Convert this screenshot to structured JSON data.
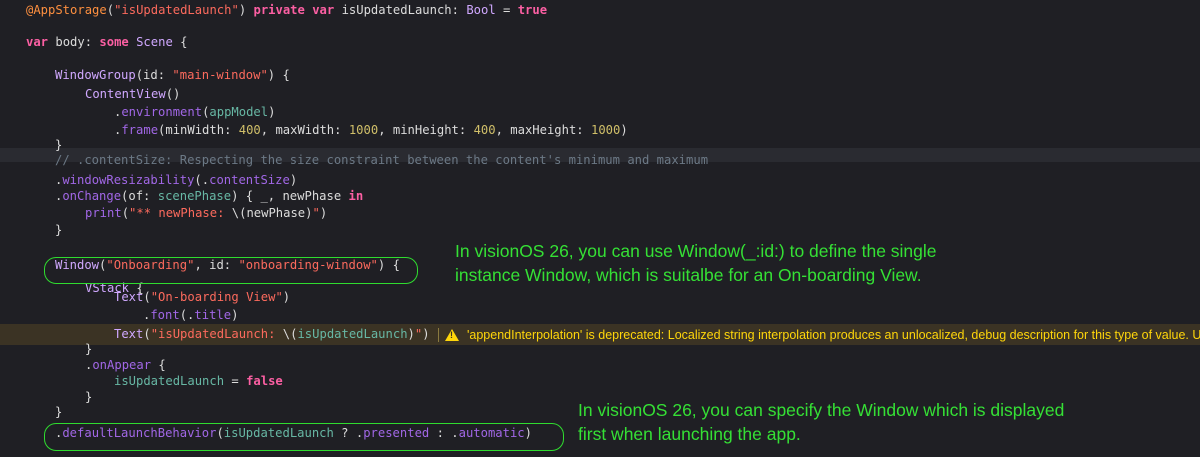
{
  "code_lines": [
    {
      "segments": [
        [
          "attr",
          "@AppStorage"
        ],
        [
          "plain",
          "("
        ],
        [
          "str",
          "\"isUpdatedLaunch\""
        ],
        [
          "plain",
          ") "
        ],
        [
          "kw",
          "private"
        ],
        [
          "plain",
          " "
        ],
        [
          "kw",
          "var"
        ],
        [
          "plain",
          " isUpdatedLaunch: "
        ],
        [
          "type",
          "Bool"
        ],
        [
          "plain",
          " = "
        ],
        [
          "kw",
          "true"
        ]
      ]
    },
    {
      "segments": []
    },
    {
      "segments": [
        [
          "kw",
          "var"
        ],
        [
          "plain",
          " body: "
        ],
        [
          "kw",
          "some"
        ],
        [
          "plain",
          " "
        ],
        [
          "type",
          "Scene"
        ],
        [
          "plain",
          " {"
        ]
      ]
    },
    {
      "segments": []
    },
    {
      "segments": [
        [
          "type",
          "WindowGroup"
        ],
        [
          "plain",
          "(id: "
        ],
        [
          "str",
          "\"main-window\""
        ],
        [
          "plain",
          ") {"
        ]
      ]
    },
    {
      "segments": [
        [
          "type",
          "ContentView"
        ],
        [
          "plain",
          "()"
        ]
      ]
    },
    {
      "segments": [
        [
          "plain",
          "."
        ],
        [
          "member",
          "environment"
        ],
        [
          "plain",
          "("
        ],
        [
          "prop",
          "appModel"
        ],
        [
          "plain",
          ")"
        ]
      ]
    },
    {
      "segments": [
        [
          "plain",
          "."
        ],
        [
          "member",
          "frame"
        ],
        [
          "plain",
          "(minWidth: "
        ],
        [
          "num",
          "400"
        ],
        [
          "plain",
          ", maxWidth: "
        ],
        [
          "num",
          "1000"
        ],
        [
          "plain",
          ", minHeight: "
        ],
        [
          "num",
          "400"
        ],
        [
          "plain",
          ", maxHeight: "
        ],
        [
          "num",
          "1000"
        ],
        [
          "plain",
          ")"
        ]
      ]
    },
    {
      "segments": [
        [
          "plain",
          "}"
        ]
      ]
    },
    {
      "segments": [
        [
          "cmt",
          "// .contentSize: Respecting the size constraint between the content's minimum and maximum"
        ]
      ]
    },
    {
      "segments": [
        [
          "plain",
          "."
        ],
        [
          "member",
          "windowResizability"
        ],
        [
          "plain",
          "(."
        ],
        [
          "member",
          "contentSize"
        ],
        [
          "plain",
          ")"
        ]
      ]
    },
    {
      "segments": [
        [
          "plain",
          "."
        ],
        [
          "member",
          "onChange"
        ],
        [
          "plain",
          "(of: "
        ],
        [
          "prop",
          "scenePhase"
        ],
        [
          "plain",
          ") { _, newPhase "
        ],
        [
          "kw",
          "in"
        ]
      ]
    },
    {
      "segments": [
        [
          "member",
          "print"
        ],
        [
          "plain",
          "("
        ],
        [
          "str",
          "\"** newPhase: "
        ],
        [
          "plain",
          "\\(newPhase)"
        ],
        [
          "str",
          "\""
        ],
        [
          "plain",
          ")"
        ]
      ]
    },
    {
      "segments": [
        [
          "plain",
          "}"
        ]
      ]
    },
    {
      "segments": []
    },
    {
      "segments": [
        [
          "type",
          "Window"
        ],
        [
          "plain",
          "("
        ],
        [
          "str",
          "\"Onboarding\""
        ],
        [
          "plain",
          ", id: "
        ],
        [
          "str",
          "\"onboarding-window\""
        ],
        [
          "plain",
          ") {"
        ]
      ]
    },
    {
      "segments": [
        [
          "type",
          "VStack"
        ],
        [
          "plain",
          " {"
        ]
      ]
    },
    {
      "segments": [
        [
          "type",
          "Text"
        ],
        [
          "plain",
          "("
        ],
        [
          "str",
          "\"On-boarding View\""
        ],
        [
          "plain",
          ")"
        ]
      ]
    },
    {
      "segments": [
        [
          "plain",
          "."
        ],
        [
          "member",
          "font"
        ],
        [
          "plain",
          "(."
        ],
        [
          "member",
          "title"
        ],
        [
          "plain",
          ")"
        ]
      ]
    },
    {
      "segments": [
        [
          "type",
          "Text"
        ],
        [
          "plain",
          "("
        ],
        [
          "str",
          "\"isUpdatedLaunch: "
        ],
        [
          "plain",
          "\\("
        ],
        [
          "prop",
          "isUpdatedLaunch"
        ],
        [
          "plain",
          ")"
        ],
        [
          "str",
          "\""
        ],
        [
          "plain",
          ")"
        ]
      ]
    },
    {
      "segments": [
        [
          "plain",
          "}"
        ]
      ]
    },
    {
      "segments": [
        [
          "plain",
          "."
        ],
        [
          "member",
          "onAppear"
        ],
        [
          "plain",
          " {"
        ]
      ]
    },
    {
      "segments": [
        [
          "prop",
          "isUpdatedLaunch"
        ],
        [
          "plain",
          " = "
        ],
        [
          "kw",
          "false"
        ]
      ]
    },
    {
      "segments": [
        [
          "plain",
          "}"
        ]
      ]
    },
    {
      "segments": [
        [
          "plain",
          "}"
        ]
      ]
    },
    {
      "segments": [
        [
          "plain",
          "."
        ],
        [
          "member",
          "defaultLaunchBehavior"
        ],
        [
          "plain",
          "("
        ],
        [
          "prop",
          "isUpdatedLaunch"
        ],
        [
          "plain",
          " ? ."
        ],
        [
          "member",
          "presented"
        ],
        [
          "plain",
          " : ."
        ],
        [
          "member",
          "automatic"
        ],
        [
          "plain",
          ")"
        ]
      ]
    }
  ],
  "warning": {
    "icon": "warning-triangle-icon",
    "message": "'appendInterpolation' is deprecated: Localized string interpolation produces an unlocalized, debug description for this type of value. Us"
  },
  "annotations": {
    "window_note": {
      "line1": "In visionOS 26, you can use Window(_:id:) to define the single",
      "line2": "instance Window, which is suitalbe for an On-boarding View."
    },
    "launch_note": {
      "line1": "In visionOS 26, you can specify the Window which is displayed",
      "line2": "first when launching the app."
    }
  },
  "colors": {
    "background": "#1f1f24",
    "annotation_green": "#2fdc2f",
    "warning_yellow": "#ffd60a"
  }
}
